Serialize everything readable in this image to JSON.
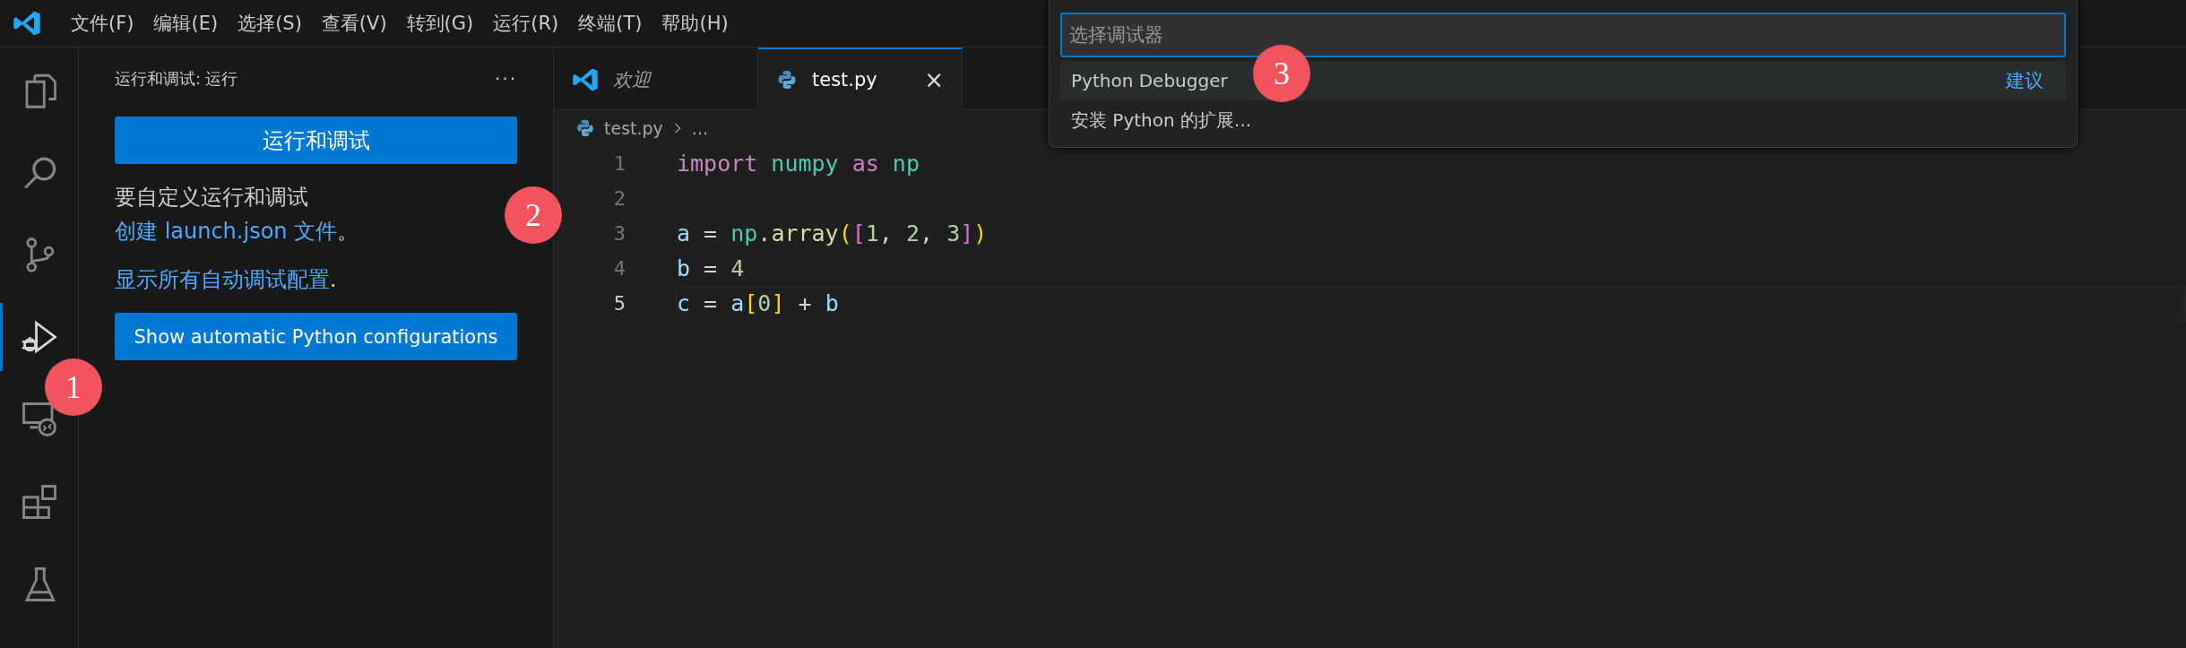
{
  "menu_bar": {
    "items": [
      "文件(F)",
      "编辑(E)",
      "选择(S)",
      "查看(V)",
      "转到(G)",
      "运行(R)",
      "终端(T)",
      "帮助(H)"
    ]
  },
  "activity_bar": {
    "items": [
      {
        "kind": "files",
        "selected": false
      },
      {
        "kind": "search",
        "selected": false
      },
      {
        "kind": "source-control",
        "selected": false
      },
      {
        "kind": "run-debug",
        "selected": true
      },
      {
        "kind": "remote",
        "selected": false
      },
      {
        "kind": "extensions",
        "selected": false
      },
      {
        "kind": "testing",
        "selected": false
      }
    ]
  },
  "sidebar": {
    "title": "运行和调试: 运行",
    "more": "···",
    "run_button": "运行和调试",
    "hint": {
      "before": "要自定义运行和调试",
      "link": "创建 launch.json 文件",
      "after": "。"
    },
    "show_all": {
      "link": "显示所有自动调试配置",
      "after": "."
    },
    "python_button": "Show automatic Python configurations"
  },
  "editor": {
    "tabs": [
      {
        "label": "欢迎",
        "kind": "welcome",
        "selected": false
      },
      {
        "label": "test.py",
        "kind": "python",
        "selected": true,
        "close": "×"
      }
    ],
    "breadcrumb": [
      "test.py",
      "..."
    ],
    "lines": [
      {
        "number": "1",
        "current": false,
        "tokens": [
          {
            "t": "import",
            "color": "#c586c0"
          },
          {
            "t": " numpy",
            "color": "#4ec9b0"
          },
          {
            "t": " as",
            "color": "#c586c0"
          },
          {
            "t": " np",
            "color": "#4ec9b0"
          }
        ]
      },
      {
        "number": "2",
        "current": false
      },
      {
        "number": "3",
        "current": false,
        "tokens": [
          {
            "t": "a",
            "color": "#9cdcfe"
          },
          {
            "t": " = ",
            "color": "#d4d4d4"
          },
          {
            "t": "np",
            "color": "#4ec9b0"
          },
          {
            "t": ".",
            "color": "#d4d4d4"
          },
          {
            "t": "array",
            "color": "#dcdcaa"
          },
          {
            "t": "(",
            "color": "#ffd700"
          },
          {
            "t": "[",
            "color": "#da70d6"
          },
          {
            "t": "1",
            "color": "#b5cea8"
          },
          {
            "t": ", ",
            "color": "#d4d4d4"
          },
          {
            "t": "2",
            "color": "#b5cea8"
          },
          {
            "t": ", ",
            "color": "#d4d4d4"
          },
          {
            "t": "3",
            "color": "#b5cea8"
          },
          {
            "t": "]",
            "color": "#da70d6"
          },
          {
            "t": ")",
            "color": "#ffd700"
          }
        ]
      },
      {
        "number": "4",
        "current": false,
        "tokens": [
          {
            "t": "b",
            "color": "#9cdcfe"
          },
          {
            "t": " = ",
            "color": "#d4d4d4"
          },
          {
            "t": "4",
            "color": "#b5cea8"
          }
        ]
      },
      {
        "number": "5",
        "current": true,
        "tokens": [
          {
            "t": "c",
            "color": "#9cdcfe"
          },
          {
            "t": " = ",
            "color": "#d4d4d4"
          },
          {
            "t": "a",
            "color": "#9cdcfe"
          },
          {
            "t": "[",
            "color": "#ffd700"
          },
          {
            "t": "0",
            "color": "#b5cea8"
          },
          {
            "t": "]",
            "color": "#ffd700"
          },
          {
            "t": " + ",
            "color": "#d4d4d4"
          },
          {
            "t": "b",
            "color": "#9cdcfe"
          }
        ]
      }
    ]
  },
  "quick_pick": {
    "placeholder": "选择调试器",
    "items": [
      {
        "label": "Python Debugger",
        "tag": "建议",
        "selected": true
      },
      {
        "label": "安装 Python 的扩展...",
        "selected": false
      }
    ]
  },
  "markers": [
    {
      "number": "1"
    },
    {
      "number": "2"
    },
    {
      "number": "3"
    }
  ]
}
